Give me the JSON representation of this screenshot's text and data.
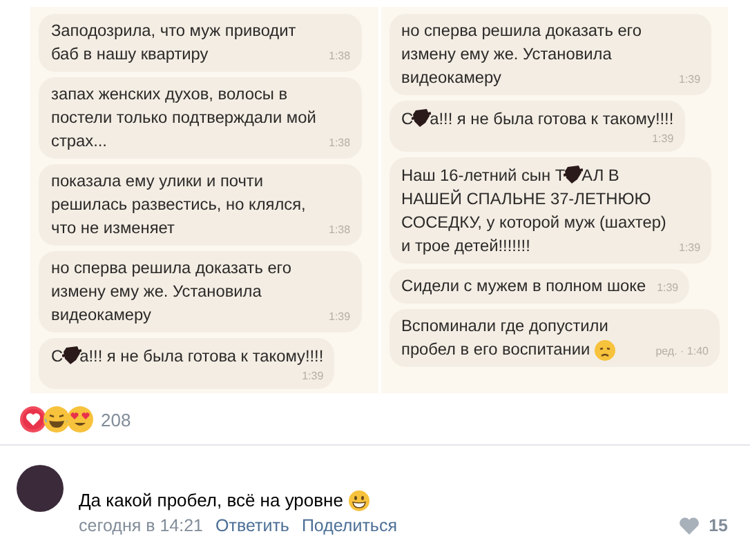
{
  "screenshots": [
    {
      "messages": [
        {
          "kind": "plain",
          "parts": [
            "Заподозрила, что муж приводит баб в нашу квартиру"
          ],
          "time": "1:38"
        },
        {
          "kind": "plain",
          "parts": [
            "запах женских духов, волосы в постели только подтверждали мой страх..."
          ],
          "time": "1:38"
        },
        {
          "kind": "plain",
          "parts": [
            "показала ему улики и почти решилась развестись, но клялся, что не изменяет"
          ],
          "time": "1:38"
        },
        {
          "kind": "plain",
          "parts": [
            "но сперва решила доказать его измену ему же. Установила видеокамеру"
          ],
          "time": "1:39"
        },
        {
          "kind": "time-below",
          "parts": [
            "С",
            "а!!! я не была готова к такому!!!!"
          ],
          "time": "1:39"
        }
      ]
    },
    {
      "messages": [
        {
          "kind": "plain",
          "parts": [
            "но сперва решила доказать его измену ему же. Установила видеокамеру"
          ],
          "time": "1:39"
        },
        {
          "kind": "time-below",
          "parts": [
            "С",
            "а!!! я не была готова к такому!!!!"
          ],
          "time": "1:39"
        },
        {
          "kind": "plain",
          "parts": [
            "Наш 16-летний сын T",
            "АЛ В НАШЕЙ СПАЛЬНЕ 37-ЛЕТНЮЮ СОСЕДКУ, у которой муж (шахтер) и трое детей!!!!!!!"
          ],
          "time": "1:39"
        },
        {
          "kind": "plain",
          "parts": [
            "Сидели с мужем в полном шоке"
          ],
          "time": "1:39"
        },
        {
          "kind": "sad-emoji",
          "parts": [
            "Вспоминали где допустили пробел в его воспитании"
          ],
          "time": "ред. · 1:40"
        }
      ]
    }
  ],
  "reactions": {
    "count": "208"
  },
  "comment": {
    "kind": "grin-emoji",
    "text": "Да какой пробел, всё на уровне",
    "date": "сегодня в 14:21",
    "actions": [
      "Ответить",
      "Поделиться"
    ],
    "likes": "15",
    "liked": false
  }
}
